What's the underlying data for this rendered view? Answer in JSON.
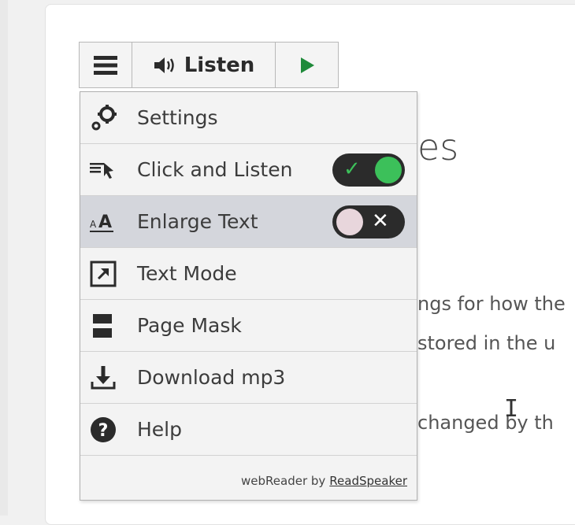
{
  "toolbar": {
    "listen_label": "Listen"
  },
  "menu": {
    "items": [
      {
        "label": "Settings"
      },
      {
        "label": "Click and Listen",
        "toggle": "on"
      },
      {
        "label": "Enlarge Text",
        "toggle": "off"
      },
      {
        "label": "Text Mode"
      },
      {
        "label": "Page Mask"
      },
      {
        "label": "Download mp3"
      },
      {
        "label": "Help"
      }
    ],
    "footer_prefix": "webReader by",
    "footer_brand": "ReadSpeaker"
  },
  "background": {
    "heading_fragment": "es",
    "line1": "ngs for how the",
    "line2": "stored in the u",
    "line3": "changed by th"
  },
  "colors": {
    "toggle_on": "#3cc05a",
    "toggle_track": "#2b2b2b",
    "play": "#1f8a3a",
    "active_row": "#d4d6dc"
  }
}
